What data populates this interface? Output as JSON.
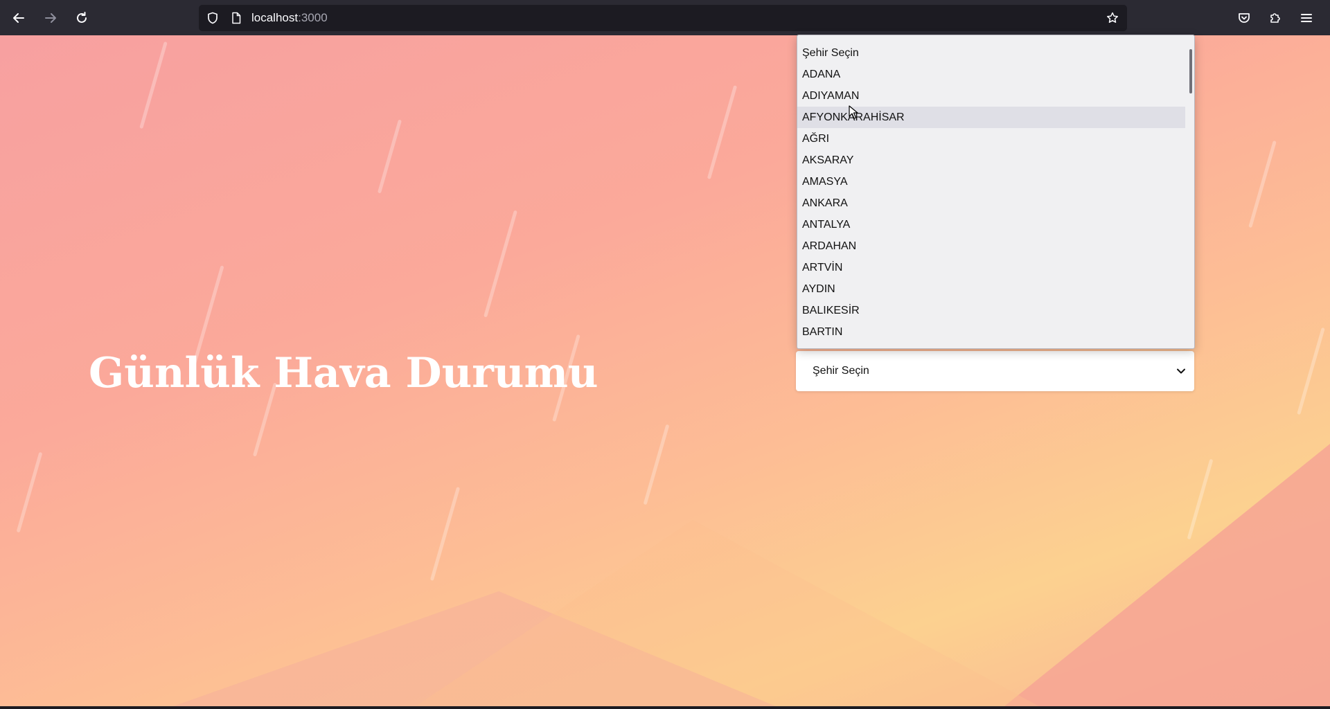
{
  "browser": {
    "url_host": "localhost",
    "url_port": ":3000",
    "icons": [
      "back-arrow-icon",
      "forward-arrow-icon",
      "reload-icon",
      "shield-icon",
      "page-icon",
      "star-icon",
      "pocket-icon",
      "extensions-icon",
      "menu-icon"
    ]
  },
  "page": {
    "title": "Günlük Hava Durumu",
    "select": {
      "value": "Şehir Seçin",
      "options": [
        "Şehir Seçin",
        "ADANA",
        "ADIYAMAN",
        "AFYONKARAHİSAR",
        "AĞRI",
        "AKSARAY",
        "AMASYA",
        "ANKARA",
        "ANTALYA",
        "ARDAHAN",
        "ARTVİN",
        "AYDIN",
        "BALIKESİR",
        "BARTIN"
      ],
      "highlighted": "AFYONKARAHİSAR"
    }
  },
  "colors": {
    "chrome": "#2b2a33",
    "urlbar": "#1c1b22",
    "title_text": "#ffffff",
    "dropdown_bg": "#f0f0f2",
    "option_hover": "#dfdfe6"
  }
}
